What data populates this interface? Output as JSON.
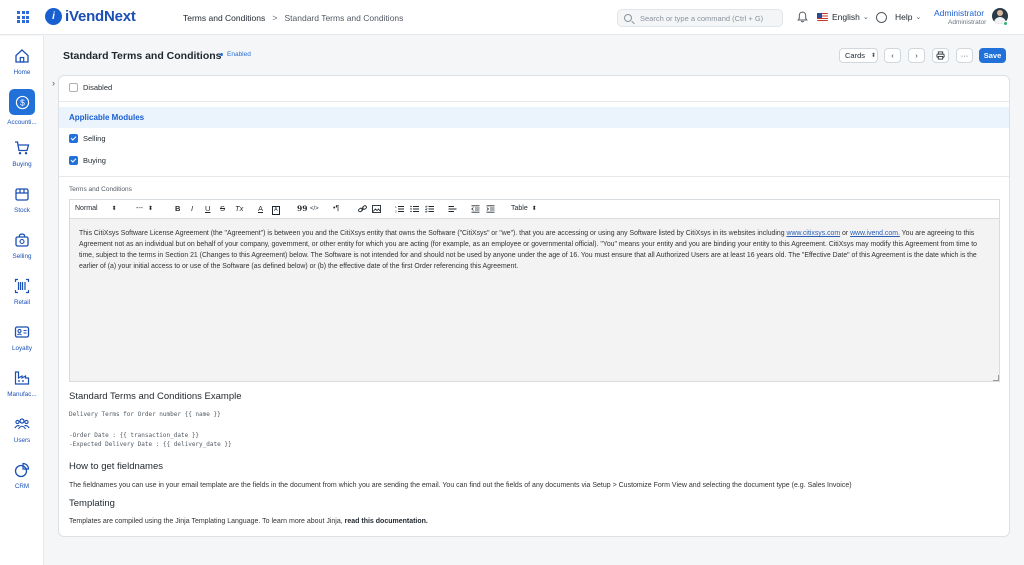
{
  "app": {
    "name": "iVendNext",
    "logo_letter": "i"
  },
  "breadcrumb": {
    "root": "Terms and Conditions",
    "separator": ">",
    "current": "Standard Terms and Conditions"
  },
  "search": {
    "placeholder": "Search or type a command (Ctrl + G)"
  },
  "header": {
    "language": "English",
    "help": "Help",
    "user_name": "Administrator",
    "user_role": "Administrator"
  },
  "sidebar": {
    "items": [
      {
        "label": "Home",
        "icon": "home-icon"
      },
      {
        "label": "Accounti...",
        "icon": "dollar-icon",
        "active": true
      },
      {
        "label": "Buying",
        "icon": "cart-icon"
      },
      {
        "label": "Stock",
        "icon": "box-icon"
      },
      {
        "label": "Selling",
        "icon": "bag-icon"
      },
      {
        "label": "Retail",
        "icon": "barcode-icon"
      },
      {
        "label": "Loyalty",
        "icon": "id-card-icon"
      },
      {
        "label": "Manufac...",
        "icon": "factory-icon"
      },
      {
        "label": "Users",
        "icon": "users-icon"
      },
      {
        "label": "CRM",
        "icon": "pie-chart-icon"
      }
    ]
  },
  "page": {
    "title": "Standard Terms and Conditions",
    "status": "Enabled",
    "view_select": "Cards",
    "save_label": "Save",
    "more_label": "···"
  },
  "form": {
    "disabled_label": "Disabled",
    "disabled_checked": false,
    "modules_heading": "Applicable Modules",
    "selling_label": "Selling",
    "selling_checked": true,
    "buying_label": "Buying",
    "buying_checked": true,
    "terms_label": "Terms and Conditions"
  },
  "editor": {
    "toolbar": {
      "format": "Normal",
      "size": "---",
      "bold": "B",
      "italic": "I",
      "underline": "U",
      "strike": "S",
      "clear": "Tx",
      "color": "A",
      "bg": "A",
      "quote": "99",
      "code": "</>",
      "pilcrow": "•¶",
      "table": "Table"
    },
    "text_1": "This CitiXsys Software License Agreement (the \"Agreement\") is between you and the CitiXsys entity that owns the Software (\"CitiXsys\" or \"we\"). that you are accessing or using any Software listed by CitiXsys in its websites including ",
    "link_1": "www.citixsys.com",
    "text_2": " or ",
    "link_2": "www.ivend.com.",
    "text_3": " You are agreeing to this Agreement not as an individual but on behalf of your company, government, or other entity for which you are acting (for example, as an employee or governmental official). \"You\" means your entity and you are binding your entity to this Agreement. CitiXsys may modify this Agreement from time to time, subject to the terms in Section 21 (Changes to this Agreement) below. The Software is not intended for and should not be used by anyone under the age of 16. You must ensure that all Authorized Users are at least 16 years old. The \"Effective Date\" of this Agreement is the date which is the earlier of (a) your initial access to or use of the Software (as defined below) or (b) the effective date of the first Order referencing this Agreement."
  },
  "help": {
    "example_heading": "Standard Terms and Conditions Example",
    "example_line_1": "Delivery Terms for Order number {{ name }}",
    "example_line_2": "-Order Date : {{ transaction_date }}",
    "example_line_3": "-Expected Delivery Date : {{ delivery_date }}",
    "fieldnames_heading": "How to get fieldnames",
    "fieldnames_text": "The fieldnames you can use in your email template are the fields in the document from which you are sending the email. You can find out the fields of any documents via Setup > Customize Form View and selecting the document type (e.g. Sales Invoice)",
    "templating_heading": "Templating",
    "templating_text": "Templates are compiled using the Jinja Templating Language. To learn more about Jinja, ",
    "templating_link": "read this documentation."
  },
  "colors": {
    "accent": "#2271d9",
    "brand": "#1a4fb5",
    "section_bg": "#ebf3fc",
    "editor_bg": "#f3f3f3"
  }
}
